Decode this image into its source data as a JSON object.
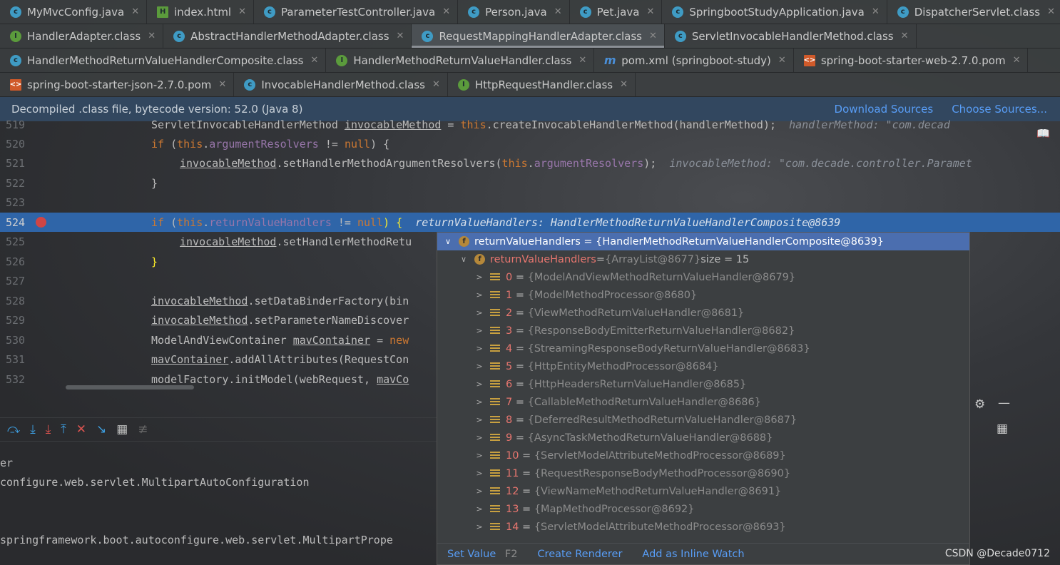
{
  "tabs": [
    [
      {
        "label": "MyMvcConfig.java",
        "icon": "c"
      },
      {
        "label": "index.html",
        "icon": "h"
      },
      {
        "label": "ParameterTestController.java",
        "icon": "c"
      },
      {
        "label": "Person.java",
        "icon": "c"
      },
      {
        "label": "Pet.java",
        "icon": "c"
      },
      {
        "label": "SpringbootStudyApplication.java",
        "icon": "c"
      },
      {
        "label": "DispatcherServlet.class",
        "icon": "c"
      }
    ],
    [
      {
        "label": "HandlerAdapter.class",
        "icon": "i"
      },
      {
        "label": "AbstractHandlerMethodAdapter.class",
        "icon": "c"
      },
      {
        "label": "RequestMappingHandlerAdapter.class",
        "icon": "c",
        "active": true
      },
      {
        "label": "ServletInvocableHandlerMethod.class",
        "icon": "c"
      }
    ],
    [
      {
        "label": "HandlerMethodReturnValueHandlerComposite.class",
        "icon": "c"
      },
      {
        "label": "HandlerMethodReturnValueHandler.class",
        "icon": "i"
      },
      {
        "label": "pom.xml (springboot-study)",
        "icon": "m"
      },
      {
        "label": "spring-boot-starter-web-2.7.0.pom",
        "icon": "p"
      }
    ],
    [
      {
        "label": "spring-boot-starter-json-2.7.0.pom",
        "icon": "p"
      },
      {
        "label": "InvocableHandlerMethod.class",
        "icon": "c"
      },
      {
        "label": "HttpRequestHandler.class",
        "icon": "i"
      }
    ]
  ],
  "info": {
    "text": "Decompiled .class file, bytecode version: 52.0 (Java 8)",
    "download": "Download Sources",
    "choose": "Choose Sources..."
  },
  "code": {
    "l519": "519",
    "t519a": "ServletInvocableHandlerMethod ",
    "t519b": "invocableMethod",
    "t519c": " = ",
    "t519d": "this",
    "t519e": ".createInvocableHandlerMethod(handlerMethod);",
    "h519": "  handlerMethod: \"com.decad",
    "l520": "520",
    "l521": "521",
    "l522": "522",
    "l523": "523",
    "l524": "524",
    "l525": "525",
    "l526": "526",
    "l527": "527",
    "l528": "528",
    "l529": "529",
    "l530": "530",
    "l531": "531",
    "l532": "532",
    "if": "if",
    "this": "this",
    "null": "null",
    "ne": " != ",
    "argRes": "argumentResolvers",
    "retHandlers": "returnValueHandlers",
    "open": " (",
    "closeBrace": ") {",
    "inv": "invocableMethod",
    "t521": ".setHandlerMethodArgumentResolvers(",
    "t521e": ");",
    "h521": "  invocableMethod: \"com.decade.controller.Paramet",
    "brace": "}",
    "t525": ".setHandlerMethodRetu",
    "h524": "  returnValueHandlers: HandlerMethodReturnValueHandlerComposite@8639",
    "t528": ".setDataBinderFactory(bin",
    "t529": ".setParameterNameDiscover",
    "t530a": "ModelAndViewContainer ",
    "t530b": "mavContainer",
    "t530c": " = ",
    "t530d": "new",
    "t531": ".addAllAttributes(RequestCon",
    "t532a": "modelFactory.initModel(webRequest, ",
    "t532b": "mavCo"
  },
  "console": [
    "er",
    "configure.web.servlet.MultipartAutoConfiguration",
    "",
    "",
    "springframework.boot.autoconfigure.web.servlet.MultipartPrope"
  ],
  "popup": {
    "root": "returnValueHandlers = {HandlerMethodReturnValueHandlerComposite@8639}",
    "child_name": "returnValueHandlers",
    "child_eq": " = ",
    "child_val": "{ArrayList@8677}",
    "child_size": " size = 15",
    "items": [
      {
        "i": "0",
        "v": "{ModelAndViewMethodReturnValueHandler@8679}"
      },
      {
        "i": "1",
        "v": "{ModelMethodProcessor@8680}"
      },
      {
        "i": "2",
        "v": "{ViewMethodReturnValueHandler@8681}"
      },
      {
        "i": "3",
        "v": "{ResponseBodyEmitterReturnValueHandler@8682}"
      },
      {
        "i": "4",
        "v": "{StreamingResponseBodyReturnValueHandler@8683}"
      },
      {
        "i": "5",
        "v": "{HttpEntityMethodProcessor@8684}"
      },
      {
        "i": "6",
        "v": "{HttpHeadersReturnValueHandler@8685}"
      },
      {
        "i": "7",
        "v": "{CallableMethodReturnValueHandler@8686}"
      },
      {
        "i": "8",
        "v": "{DeferredResultMethodReturnValueHandler@8687}"
      },
      {
        "i": "9",
        "v": "{AsyncTaskMethodReturnValueHandler@8688}"
      },
      {
        "i": "10",
        "v": "{ServletModelAttributeMethodProcessor@8689}"
      },
      {
        "i": "11",
        "v": "{RequestResponseBodyMethodProcessor@8690}"
      },
      {
        "i": "12",
        "v": "{ViewNameMethodReturnValueHandler@8691}"
      },
      {
        "i": "13",
        "v": "{MapMethodProcessor@8692}"
      },
      {
        "i": "14",
        "v": "{ServletModelAttributeMethodProcessor@8693}"
      }
    ],
    "set_value": "Set Value",
    "set_value_key": "F2",
    "create_renderer": "Create Renderer",
    "add_watch": "Add as Inline Watch"
  },
  "watermark": "CSDN @Decade0712",
  "colors": {
    "selection": "#2f65a8",
    "info_bar": "#32475f",
    "link": "#589df6",
    "keyword": "#cc7832",
    "field": "#9876aa"
  }
}
